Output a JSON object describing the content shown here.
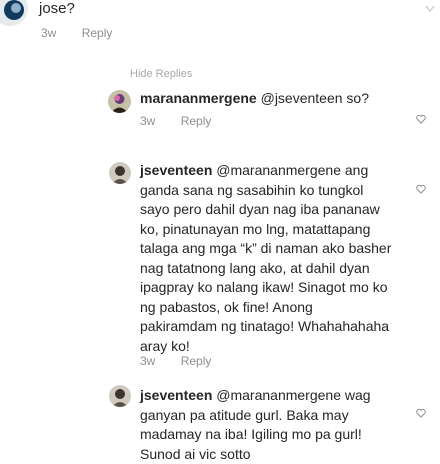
{
  "top": {
    "partial_text": "jose?",
    "time": "3w",
    "reply": "Reply"
  },
  "hide_replies": "Hide Replies",
  "comments": [
    {
      "username": "marananmergene",
      "text": " @jseventeen so?",
      "time": "3w",
      "reply": "Reply"
    },
    {
      "username": "jseventeen",
      "text": " @marananmergene ang ganda sana ng sasabihin ko tungkol sayo pero dahil dyan nag iba pananaw ko, pinatunayan mo lng, matattapang talaga ang mga “k” di naman ako basher nag tatatnong lang ako, at dahil dyan ipagpray ko nalang ikaw!  Sinagot mo ko ng pabastos, ok fine! Anong pakiramdam ng tinatago! Whahahahaha aray ko!",
      "time": "3w",
      "reply": "Reply"
    },
    {
      "username": "jseventeen",
      "text": " @marananmergene wag ganyan pa atitude gurl. Baka may madamay na iba! Igiling mo pa gurl! Sunod ai vic sotto"
    }
  ],
  "icons": {
    "heart": "heart-outline-icon",
    "chevron": "chevron-down-icon"
  },
  "colors": {
    "meta_gray": "#8e8e8e",
    "text": "#262626"
  }
}
